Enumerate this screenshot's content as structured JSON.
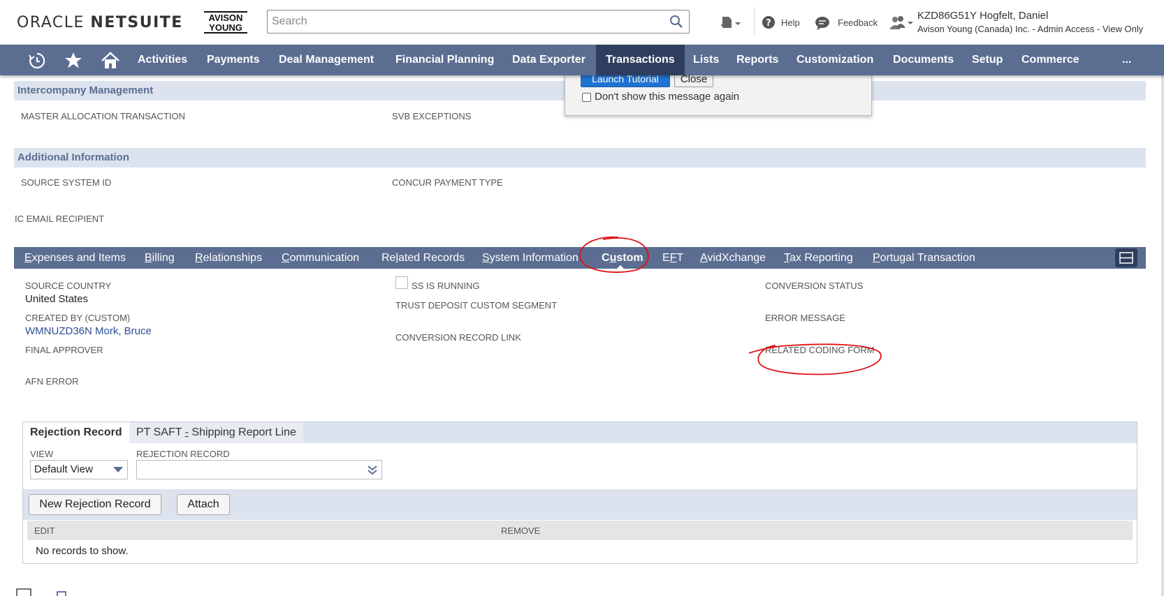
{
  "header": {
    "logo_oracle": "ORACLE",
    "logo_netsuite": "NETSUITE",
    "logo_ay_line1": "AVISON",
    "logo_ay_line2": "YOUNG",
    "search_placeholder": "Search",
    "help_label": "Help",
    "feedback_label": "Feedback",
    "user_name": "KZD86G51Y Hogfelt, Daniel",
    "user_role": "Avison Young (Canada) Inc. - Admin Access - View Only"
  },
  "nav": {
    "items": [
      "Activities",
      "Payments",
      "Deal Management",
      "Financial Planning",
      "Data Exporter",
      "Transactions",
      "Lists",
      "Reports",
      "Customization",
      "Documents",
      "Setup",
      "Commerce",
      "..."
    ],
    "active": "Transactions"
  },
  "popup": {
    "launch_label": "Launch Tutorial",
    "close_label": "Close",
    "dont_show_label": "Don't show this message again"
  },
  "intercompany": {
    "title": "Intercompany Management",
    "field1": "MASTER ALLOCATION TRANSACTION",
    "field2": "SVB EXCEPTIONS"
  },
  "additional": {
    "title": "Additional Information",
    "field1": "SOURCE SYSTEM ID",
    "field2": "CONCUR PAYMENT TYPE",
    "field3": "IC EMAIL RECIPIENT"
  },
  "subtabs": {
    "items": [
      {
        "pre": "",
        "ul": "E",
        "post": "xpenses and Items"
      },
      {
        "pre": "",
        "ul": "B",
        "post": "illing"
      },
      {
        "pre": "",
        "ul": "R",
        "post": "elationships"
      },
      {
        "pre": "",
        "ul": "C",
        "post": "ommunication"
      },
      {
        "pre": "Re",
        "ul": "l",
        "post": "ated Records"
      },
      {
        "pre": "",
        "ul": "S",
        "post": "ystem Information"
      },
      {
        "pre": "C",
        "ul": "u",
        "post": "stom"
      },
      {
        "pre": "E",
        "ul": "F",
        "post": "T"
      },
      {
        "pre": "",
        "ul": "A",
        "post": "vidXchange"
      },
      {
        "pre": "",
        "ul": "T",
        "post": "ax Reporting"
      },
      {
        "pre": "",
        "ul": "P",
        "post": "ortugal Transaction"
      }
    ],
    "active": "Custom"
  },
  "custom": {
    "source_country_label": "SOURCE COUNTRY",
    "source_country_value": "United States",
    "created_by_label": "CREATED BY (CUSTOM)",
    "created_by_value": "WMNUZD36N Mork, Bruce",
    "final_approver_label": "FINAL APPROVER",
    "afn_error_label": "AFN ERROR",
    "ss_running_label": "SS IS RUNNING",
    "trust_deposit_label": "TRUST DEPOSIT CUSTOM SEGMENT",
    "conversion_link_label": "CONVERSION RECORD LINK",
    "conversion_status_label": "CONVERSION STATUS",
    "error_message_label": "ERROR MESSAGE",
    "related_coding_label": "RELATED CODING FORM"
  },
  "rejection": {
    "tab_active": "Rejection Record",
    "tab_other_pre": "PT SAFT ",
    "tab_other_ul": "-",
    "tab_other_post": " Shipping Report Line",
    "view_label": "VIEW",
    "view_value": "Default View",
    "record_label": "REJECTION RECORD",
    "record_value": "",
    "new_button": "New Rejection Record",
    "attach_button": "Attach",
    "col_edit": "EDIT",
    "col_remove": "REMOVE",
    "empty_text": "No records to show."
  },
  "colors": {
    "nav_bg": "#5b6d91",
    "nav_active": "#2f3e5e",
    "section_bg": "#dce3ee",
    "link": "#2a4f91",
    "annotation": "#e01010"
  }
}
